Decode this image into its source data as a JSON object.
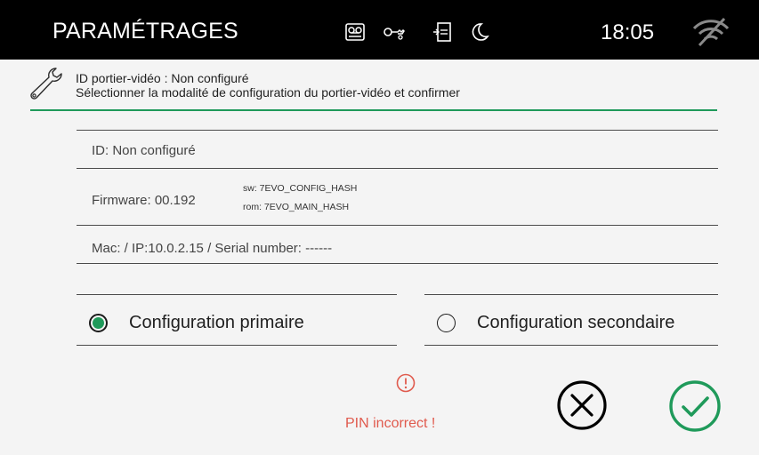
{
  "topbar": {
    "title": "PARAMÉTRAGES",
    "time": "18:05",
    "icons": [
      "voicemail-icon",
      "key-icon",
      "door-entry-icon",
      "moon-icon",
      "wifi-off-icon"
    ]
  },
  "header": {
    "line1": "ID portier-vidéo : Non configuré",
    "line2": "Sélectionner la modalité de configuration du portier-vidéo et confirmer"
  },
  "info": {
    "id": "ID: Non configuré",
    "firmware": "Firmware: 00.192",
    "sw": "sw: 7EVO_CONFIG_HASH",
    "rom": "rom: 7EVO_MAIN_HASH",
    "network": "Mac:  / IP:10.0.2.15 / Serial number: ------"
  },
  "options": {
    "primary_label": "Configuration primaire",
    "secondary_label": "Configuration secondaire",
    "selected": "primary"
  },
  "error": {
    "message": "PIN incorrect !"
  },
  "colors": {
    "accent": "#1f9a5a",
    "error": "#e05a4d",
    "topbar_bg": "#000000",
    "page_bg": "#f4f4f4"
  }
}
